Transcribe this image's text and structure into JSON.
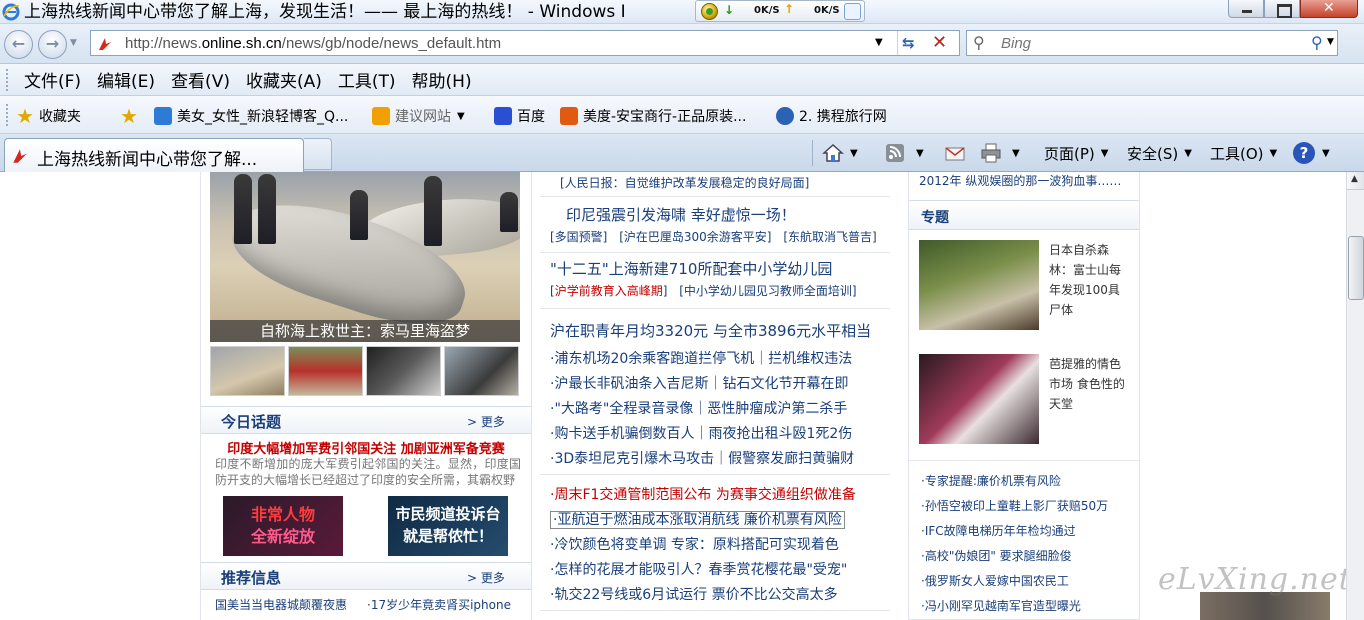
{
  "window": {
    "title": "上海热线新闻中心带您了解上海，发现生活！—— 最上海的热线！ - Windows I",
    "speed_down": "0K/S",
    "speed_up": "0K/S"
  },
  "address": {
    "url_prefix": "http://news.",
    "url_domain": "online.sh.cn",
    "url_path": "/news/gb/node/news_default.htm",
    "search_placeholder": "Bing"
  },
  "menu": [
    "文件(F)",
    "编辑(E)",
    "查看(V)",
    "收藏夹(A)",
    "工具(T)",
    "帮助(H)"
  ],
  "favorites": {
    "label": "收藏夹",
    "items": [
      {
        "label": "美女_女性_新浪轻博客_Q...",
        "color": "#2e7bd6"
      },
      {
        "label": "建议网站",
        "color": "#f0a000"
      },
      {
        "label": "百度",
        "color": "#2a4fd4"
      },
      {
        "label": "美度-安宝商行-正品原装...",
        "color": "#e05a10"
      },
      {
        "label": "2. 携程旅行网",
        "color": "#2a62b5"
      }
    ]
  },
  "tab": {
    "label": "上海热线新闻中心带您了解..."
  },
  "commands": {
    "page": "页面(P)",
    "safety": "安全(S)",
    "tools": "工具(O)"
  },
  "left": {
    "hero_caption": "自称海上救世主：索马里海盗梦",
    "today": {
      "title": "今日话题",
      "more": "> 更多",
      "headline": "印度大幅增加军费引邻国关注 加剧亚洲军备竞赛",
      "summary": "印度不断增加的庞大军费引起邻国的关注。显然，印度国防开支的大幅增长已经超过了印度的安全所需，其霸权野"
    },
    "banners": {
      "a_line1": "非常人物",
      "a_line2": "全新绽放",
      "b_line1": "市民频道投诉台",
      "b_line2": "就是帮侬忙！"
    },
    "recommend": {
      "title": "推荐信息",
      "more": "> 更多",
      "item1": "国美当当电器城颠覆夜惠",
      "item2": "·17岁少年竟卖肾买iphone"
    }
  },
  "mid": {
    "top_sub": "[人民日报：自觉维护改革发展稳定的良好局面]",
    "b1_head": "印尼强震引发海啸 幸好虚惊一场！",
    "b1_sub1": "[多国预警]",
    "b1_sub2": "[沪在巴厘岛300余游客平安]",
    "b1_sub3": "[东航取消飞普吉]",
    "b2_head": "\"十二五\"上海新建710所配套中小学幼儿园",
    "b2_sub1": "沪学前教育入高峰期",
    "b2_sub2": "[中小学幼儿园见习教师全面培训]",
    "b3_head": "沪在职青年月均3320元 与全市3896元水平相当",
    "b3_items": [
      "·浦东机场20余乘客跑道拦停飞机｜拦机维权违法",
      "·沪最长非矾油条入吉尼斯｜钻石文化节开幕在即",
      "·\"大路考\"全程录音录像｜恶性肿瘤成沪第二杀手",
      "·购卡送手机骗倒数百人｜雨夜抢出租斗殴1死2伤",
      "·3D泰坦尼克引爆木马攻击｜假警察发廊扫黄骗财"
    ],
    "b4_red": "·周末F1交通管制范围公布 为赛事交通组织做准备",
    "b4_boxed": "·亚航迫于燃油成本涨取消航线 廉价机票有风险",
    "b4_items": [
      "·冷饮颜色将变单调 专家：原料搭配可实现着色",
      "·怎样的花展才能吸引人？春季赏花樱花最\"受宠\"",
      "·轨交22号线或6月试运行 票价不比公交高太多"
    ]
  },
  "right": {
    "top": "2012年 纵观娱圈的那一波狗血事……",
    "topic_title": "专题",
    "topic1": "日本自杀森林：富士山每年发现100具尸体",
    "topic2": "芭提雅的情色市场 食色性的天堂",
    "items": [
      {
        "text": "·专家提醒:廉价机票有风险",
        "red": false
      },
      {
        "text": "·孙悟空被印上童鞋上影厂获赔50万",
        "red": false
      },
      {
        "text": "·IFC故障电梯历年年检均通过",
        "red": false
      },
      {
        "text": "·高校\"伪娘团\" 要求腿细脸俊",
        "red": false
      },
      {
        "text": "·俄罗斯女人爱嫁中国农民工",
        "red": true
      },
      {
        "text": "·冯小刚罕见越南军官造型曝光",
        "red": false
      }
    ]
  },
  "watermark": "eLvXing.net"
}
